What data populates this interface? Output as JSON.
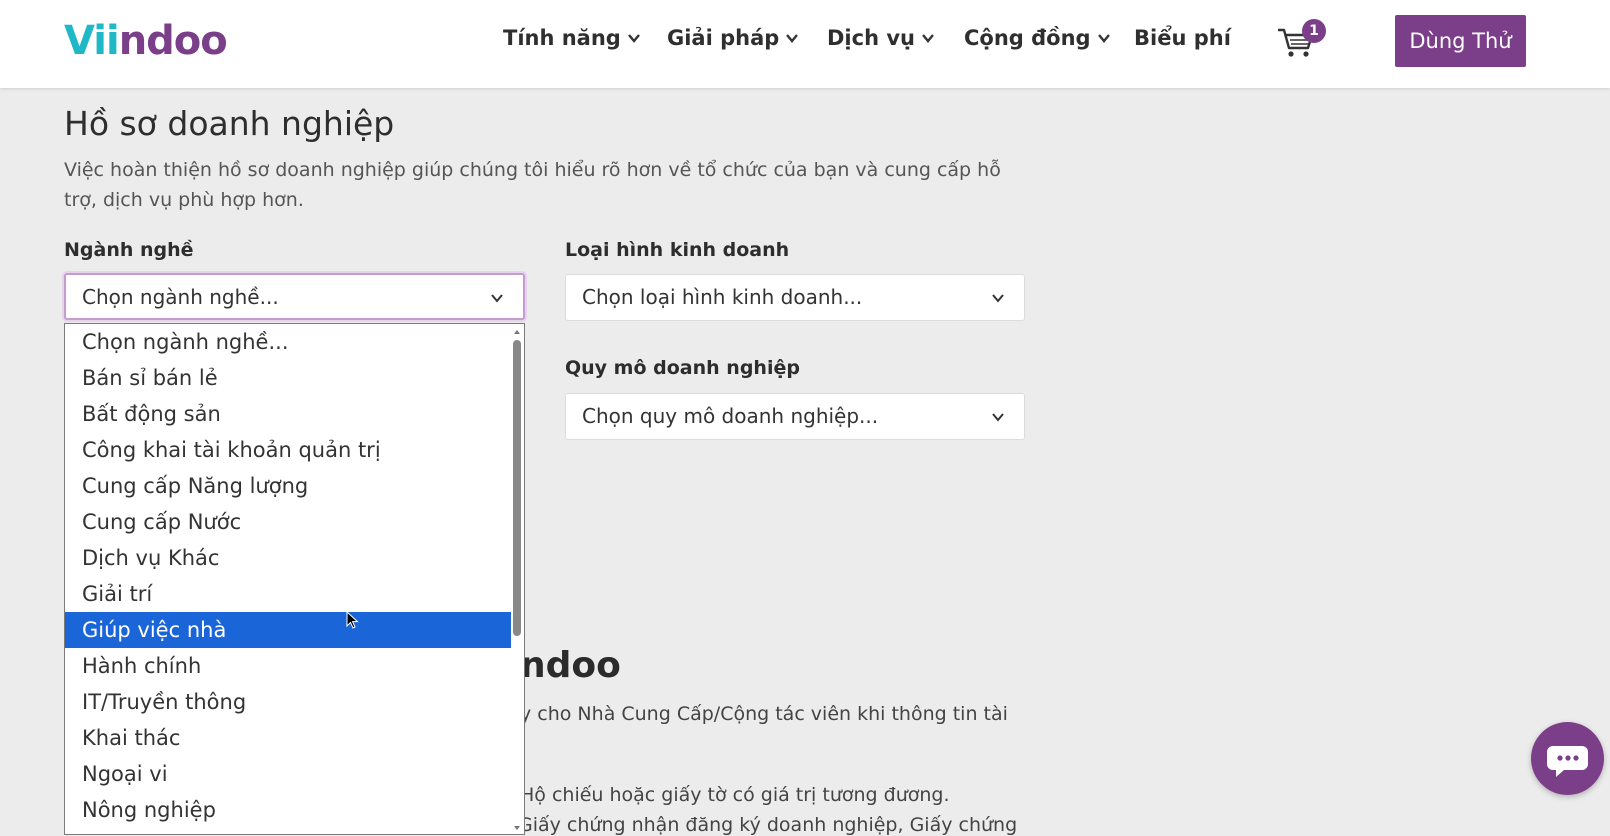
{
  "header": {
    "logo_part1": "Vii",
    "logo_part2": "ndoo",
    "nav": [
      {
        "label": "Tính năng"
      },
      {
        "label": "Giải pháp"
      },
      {
        "label": "Dịch vụ"
      },
      {
        "label": "Cộng đồng"
      },
      {
        "label": "Biểu phí"
      }
    ],
    "cart_count": "1",
    "cta_label": "Dùng Thử"
  },
  "profile": {
    "title": "Hồ sơ doanh nghiệp",
    "description": "Việc hoàn thiện hồ sơ doanh nghiệp giúp chúng tôi hiểu rõ hơn về tổ chức của bạn và cung cấp hỗ trợ, dịch vụ phù hợp hơn.",
    "industry_label": "Ngành nghề",
    "industry_value": "Chọn ngành nghề...",
    "business_type_label": "Loại hình kinh doanh",
    "business_type_value": "Chọn loại hình kinh doanh...",
    "company_size_label": "Quy mô doanh nghiệp",
    "company_size_value": "Chọn quy mô doanh nghiệp..."
  },
  "industry_options": [
    "Chọn ngành nghề...",
    "Bán sỉ bán lẻ",
    "Bất động sản",
    "Công khai tài khoản quản trị",
    "Cung cấp Năng lượng",
    "Cung cấp Nước",
    "Dịch vụ Khác",
    "Giải trí",
    "Giúp việc nhà",
    "Hành chính",
    "IT/Truyền thông",
    "Khai thác",
    "Ngoại vi",
    "Nông nghiệp"
  ],
  "highlighted_option": "Giúp việc nhà",
  "background": {
    "heading_fragment": "ndoo",
    "line1": "y cho Nhà Cung Cấp/Cộng tác viên khi thông tin tài",
    "line2": "Hộ chiếu hoặc giấy tờ có giá trị tương đương.",
    "line3": "Giấy chứng nhận đăng ký doanh nghiệp, Giấy chứng"
  },
  "colors": {
    "brand_purple": "#7b3f8a",
    "brand_teal": "#1fb8c6",
    "selection_blue": "#1a66d9"
  }
}
